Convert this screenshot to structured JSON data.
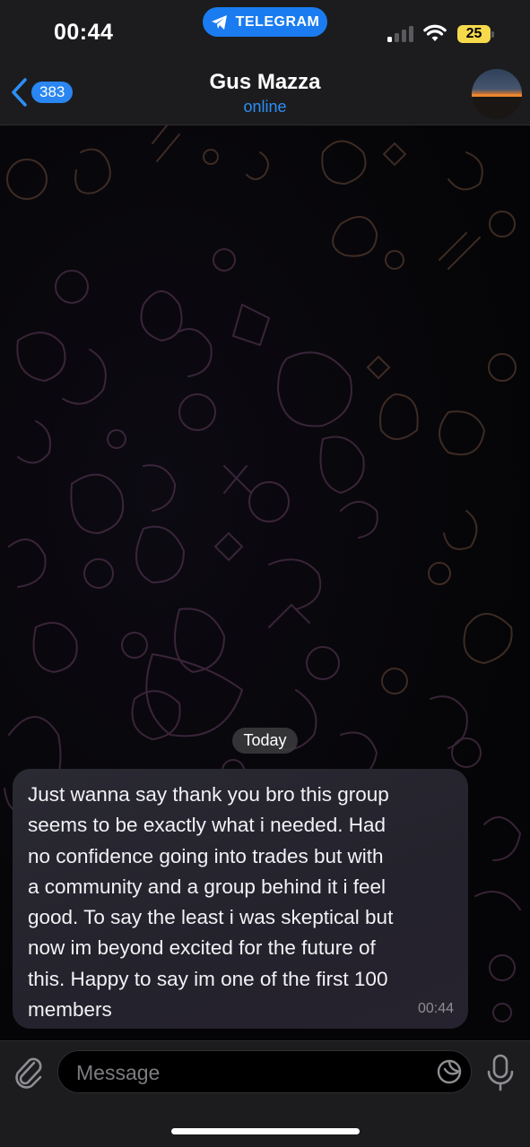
{
  "status_bar": {
    "time": "00:44",
    "app_pill": "TELEGRAM",
    "battery": "25",
    "icons": [
      "telegram-icon",
      "cellular-signal-icon",
      "wifi-icon",
      "battery-icon"
    ]
  },
  "header": {
    "back_badge": "383",
    "contact_name": "Gus Mazza",
    "contact_status": "online",
    "icons": [
      "chevron-left-icon",
      "avatar"
    ]
  },
  "chat": {
    "date_separator": "Today",
    "messages": [
      {
        "lines": [
          "Just wanna say thank you bro this group",
          "seems to be exactly what i needed. Had",
          "no confidence going into trades but with",
          "a community and a group behind it i feel",
          "good. To say the least i was skeptical but",
          "now im beyond excited for the future of",
          "this. Happy to say im one of the first 100",
          "members"
        ],
        "time": "00:44"
      }
    ]
  },
  "input_bar": {
    "placeholder": "Message",
    "icons": [
      "paperclip-icon",
      "sticker-icon",
      "microphone-icon"
    ]
  },
  "colors": {
    "accent": "#2d8ff5",
    "badge": "#2a86f0",
    "bubble": "#27252f",
    "background": "#050507",
    "battery": "#f7d94c"
  }
}
